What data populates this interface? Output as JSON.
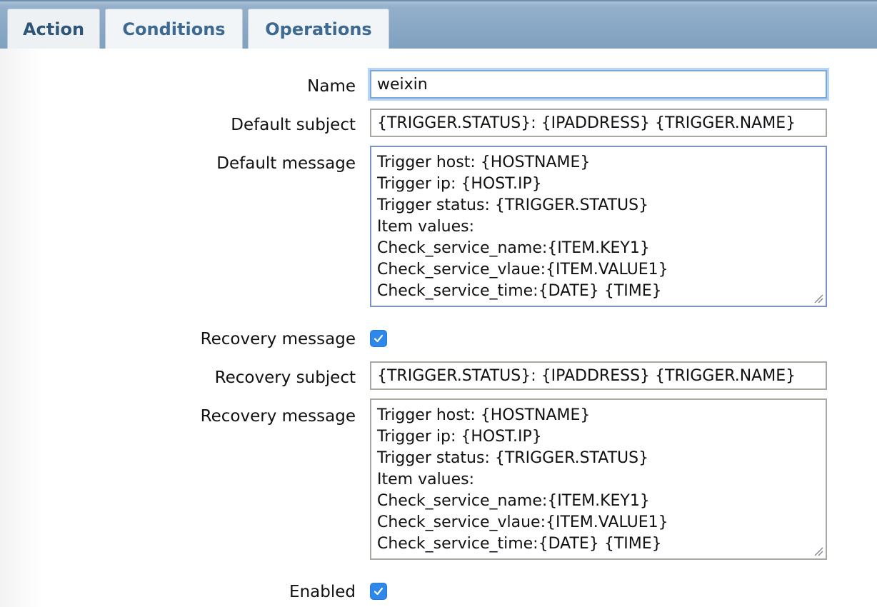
{
  "tabs": [
    {
      "label": "Action",
      "active": true
    },
    {
      "label": "Conditions",
      "active": false
    },
    {
      "label": "Operations",
      "active": false
    }
  ],
  "form": {
    "name": {
      "label": "Name",
      "value": "weixin"
    },
    "default_subject": {
      "label": "Default subject",
      "value": "{TRIGGER.STATUS}: {IPADDRESS} {TRIGGER.NAME}"
    },
    "default_message": {
      "label": "Default message",
      "lines": [
        "Trigger host: {HOSTNAME}",
        "Trigger ip: {HOST.IP}",
        "Trigger status: {TRIGGER.STATUS}",
        "Item values:",
        "Check_service_name:{ITEM.KEY1}",
        "Check_service_vlaue:{ITEM.VALUE1}",
        "Check_service_time:{DATE} {TIME}"
      ]
    },
    "recovery_message_toggle": {
      "label": "Recovery message",
      "checked": true
    },
    "recovery_subject": {
      "label": "Recovery subject",
      "value": "{TRIGGER.STATUS}: {IPADDRESS} {TRIGGER.NAME}"
    },
    "recovery_message": {
      "label": "Recovery message",
      "lines": [
        "Trigger host: {HOSTNAME}",
        "Trigger ip: {HOST.IP}",
        "Trigger status: {TRIGGER.STATUS}",
        "Item values:",
        "Check_service_name:{ITEM.KEY1}",
        "Check_service_vlaue:{ITEM.VALUE1}",
        "Check_service_time:{DATE} {TIME}"
      ]
    },
    "enabled": {
      "label": "Enabled",
      "checked": true
    }
  },
  "colors": {
    "tab_text": "#3e6a92",
    "tab_bar": "#8eabc7",
    "checkbox": "#2f87ea",
    "focus_ring": "#b9d4f2"
  }
}
